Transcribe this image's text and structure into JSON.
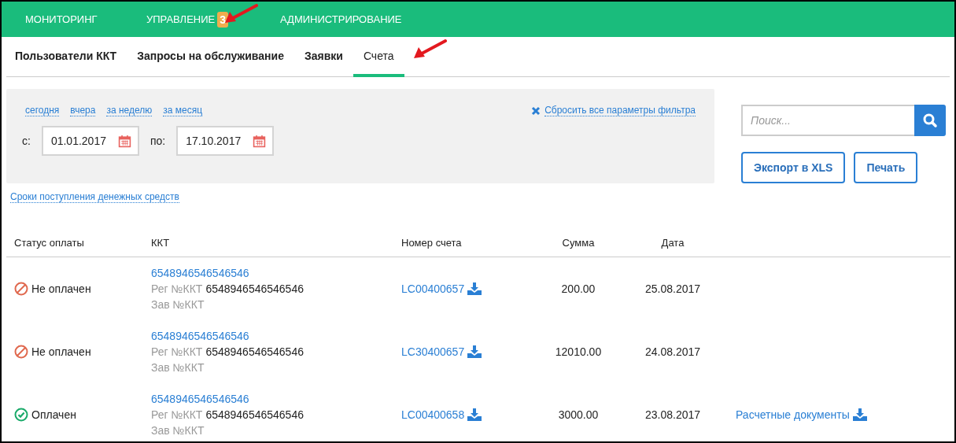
{
  "top_nav": [
    {
      "label": "МОНИТОРИНГ"
    },
    {
      "label": "УПРАВЛЕНИЕ",
      "badge": "3"
    },
    {
      "label": "АДМИНИСТРИРОВАНИЕ"
    }
  ],
  "tabs": [
    {
      "label": "Пользователи ККТ",
      "selected": false
    },
    {
      "label": "Запросы на обслуживание",
      "selected": false
    },
    {
      "label": "Заявки",
      "selected": false
    },
    {
      "label": "Счета",
      "selected": true
    }
  ],
  "filter": {
    "quick_ranges": [
      "сегодня",
      "вчера",
      "за неделю",
      "за месяц"
    ],
    "reset": "Сбросить все параметры фильтра",
    "from_label": "с:",
    "from_value": "01.01.2017",
    "to_label": "по:",
    "to_value": "17.10.2017"
  },
  "funds_link": "Сроки поступления денежных средств",
  "search": {
    "placeholder": "Поиск..."
  },
  "buttons": [
    "Экспорт в XLS",
    "Печать"
  ],
  "table": {
    "columns": [
      "Статус оплаты",
      "ККТ",
      "Номер счета",
      "Сумма",
      "Дата"
    ],
    "rows": [
      {
        "paid": false,
        "status": "Не оплачен",
        "kkt": "6548946546546546",
        "reg_label": "Рег №ККТ",
        "reg_value": "6548946546546546",
        "zav_label": "Зав №ККТ",
        "invoice": "LC00400657",
        "sum": "200.00",
        "date": "25.08.2017"
      },
      {
        "paid": false,
        "status": "Не оплачен",
        "kkt": "6548946546546546",
        "reg_label": "Рег №ККТ",
        "reg_value": "6548946546546546",
        "zav_label": "Зав №ККТ",
        "invoice": "LC30400657",
        "sum": "12010.00",
        "date": "24.08.2017"
      },
      {
        "paid": true,
        "status": "Оплачен",
        "kkt": "6548946546546546",
        "reg_label": "Рег №ККТ",
        "reg_value": "6548946546546546",
        "zav_label": "Зав №ККТ",
        "invoice": "LC00400658",
        "sum": "3000.00",
        "date": "23.08.2017",
        "documents": "Расчетные документы"
      }
    ]
  }
}
